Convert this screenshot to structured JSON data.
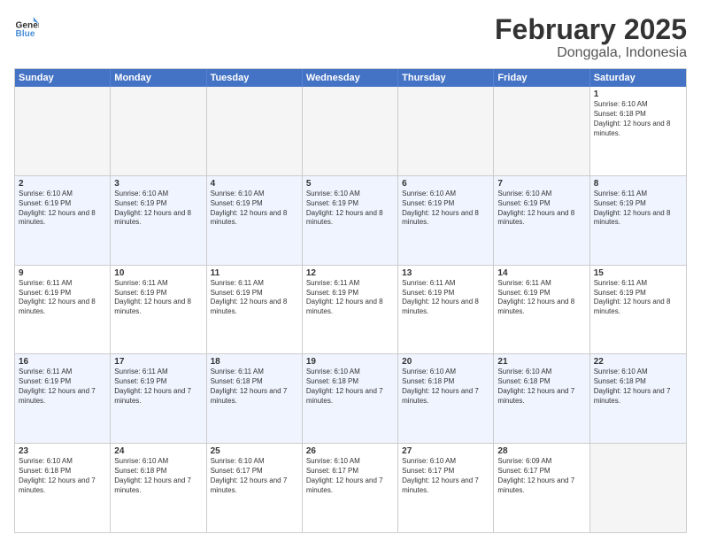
{
  "logo": {
    "line1": "General",
    "line2": "Blue"
  },
  "title": "February 2025",
  "location": "Donggala, Indonesia",
  "days": [
    "Sunday",
    "Monday",
    "Tuesday",
    "Wednesday",
    "Thursday",
    "Friday",
    "Saturday"
  ],
  "rows": [
    [
      {
        "day": "",
        "text": ""
      },
      {
        "day": "",
        "text": ""
      },
      {
        "day": "",
        "text": ""
      },
      {
        "day": "",
        "text": ""
      },
      {
        "day": "",
        "text": ""
      },
      {
        "day": "",
        "text": ""
      },
      {
        "day": "1",
        "text": "Sunrise: 6:10 AM\nSunset: 6:18 PM\nDaylight: 12 hours and 8 minutes."
      }
    ],
    [
      {
        "day": "2",
        "text": "Sunrise: 6:10 AM\nSunset: 6:19 PM\nDaylight: 12 hours and 8 minutes."
      },
      {
        "day": "3",
        "text": "Sunrise: 6:10 AM\nSunset: 6:19 PM\nDaylight: 12 hours and 8 minutes."
      },
      {
        "day": "4",
        "text": "Sunrise: 6:10 AM\nSunset: 6:19 PM\nDaylight: 12 hours and 8 minutes."
      },
      {
        "day": "5",
        "text": "Sunrise: 6:10 AM\nSunset: 6:19 PM\nDaylight: 12 hours and 8 minutes."
      },
      {
        "day": "6",
        "text": "Sunrise: 6:10 AM\nSunset: 6:19 PM\nDaylight: 12 hours and 8 minutes."
      },
      {
        "day": "7",
        "text": "Sunrise: 6:10 AM\nSunset: 6:19 PM\nDaylight: 12 hours and 8 minutes."
      },
      {
        "day": "8",
        "text": "Sunrise: 6:11 AM\nSunset: 6:19 PM\nDaylight: 12 hours and 8 minutes."
      }
    ],
    [
      {
        "day": "9",
        "text": "Sunrise: 6:11 AM\nSunset: 6:19 PM\nDaylight: 12 hours and 8 minutes."
      },
      {
        "day": "10",
        "text": "Sunrise: 6:11 AM\nSunset: 6:19 PM\nDaylight: 12 hours and 8 minutes."
      },
      {
        "day": "11",
        "text": "Sunrise: 6:11 AM\nSunset: 6:19 PM\nDaylight: 12 hours and 8 minutes."
      },
      {
        "day": "12",
        "text": "Sunrise: 6:11 AM\nSunset: 6:19 PM\nDaylight: 12 hours and 8 minutes."
      },
      {
        "day": "13",
        "text": "Sunrise: 6:11 AM\nSunset: 6:19 PM\nDaylight: 12 hours and 8 minutes."
      },
      {
        "day": "14",
        "text": "Sunrise: 6:11 AM\nSunset: 6:19 PM\nDaylight: 12 hours and 8 minutes."
      },
      {
        "day": "15",
        "text": "Sunrise: 6:11 AM\nSunset: 6:19 PM\nDaylight: 12 hours and 8 minutes."
      }
    ],
    [
      {
        "day": "16",
        "text": "Sunrise: 6:11 AM\nSunset: 6:19 PM\nDaylight: 12 hours and 7 minutes."
      },
      {
        "day": "17",
        "text": "Sunrise: 6:11 AM\nSunset: 6:19 PM\nDaylight: 12 hours and 7 minutes."
      },
      {
        "day": "18",
        "text": "Sunrise: 6:11 AM\nSunset: 6:18 PM\nDaylight: 12 hours and 7 minutes."
      },
      {
        "day": "19",
        "text": "Sunrise: 6:10 AM\nSunset: 6:18 PM\nDaylight: 12 hours and 7 minutes."
      },
      {
        "day": "20",
        "text": "Sunrise: 6:10 AM\nSunset: 6:18 PM\nDaylight: 12 hours and 7 minutes."
      },
      {
        "day": "21",
        "text": "Sunrise: 6:10 AM\nSunset: 6:18 PM\nDaylight: 12 hours and 7 minutes."
      },
      {
        "day": "22",
        "text": "Sunrise: 6:10 AM\nSunset: 6:18 PM\nDaylight: 12 hours and 7 minutes."
      }
    ],
    [
      {
        "day": "23",
        "text": "Sunrise: 6:10 AM\nSunset: 6:18 PM\nDaylight: 12 hours and 7 minutes."
      },
      {
        "day": "24",
        "text": "Sunrise: 6:10 AM\nSunset: 6:18 PM\nDaylight: 12 hours and 7 minutes."
      },
      {
        "day": "25",
        "text": "Sunrise: 6:10 AM\nSunset: 6:17 PM\nDaylight: 12 hours and 7 minutes."
      },
      {
        "day": "26",
        "text": "Sunrise: 6:10 AM\nSunset: 6:17 PM\nDaylight: 12 hours and 7 minutes."
      },
      {
        "day": "27",
        "text": "Sunrise: 6:10 AM\nSunset: 6:17 PM\nDaylight: 12 hours and 7 minutes."
      },
      {
        "day": "28",
        "text": "Sunrise: 6:09 AM\nSunset: 6:17 PM\nDaylight: 12 hours and 7 minutes."
      },
      {
        "day": "",
        "text": ""
      }
    ]
  ],
  "alt_rows": [
    1,
    3
  ]
}
